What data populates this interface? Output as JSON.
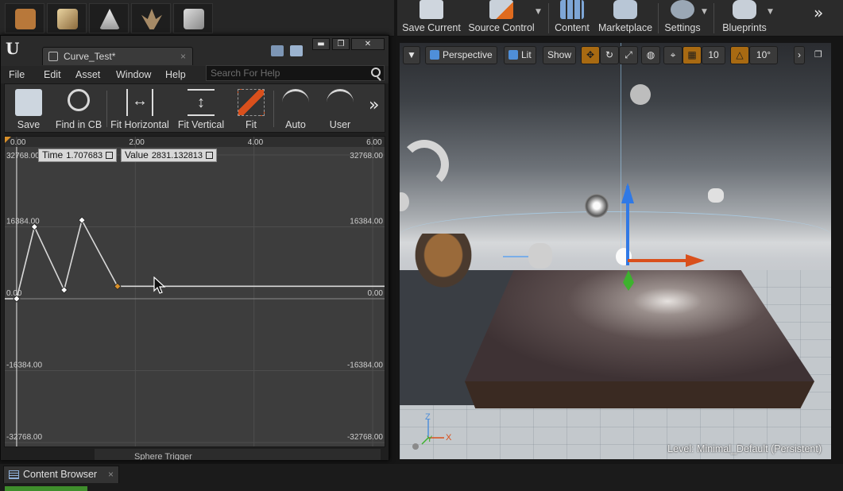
{
  "main_toolbar": {
    "buttons": [
      {
        "label": "Save Current",
        "icon": "save-icon"
      },
      {
        "label": "Source Control",
        "icon": "source-control-icon"
      },
      {
        "label": "Content",
        "icon": "content-icon"
      },
      {
        "label": "Marketplace",
        "icon": "marketplace-icon"
      },
      {
        "label": "Settings",
        "icon": "gear-icon"
      },
      {
        "label": "Blueprints",
        "icon": "blueprints-icon"
      }
    ],
    "more": "»"
  },
  "curve_editor": {
    "tab_title": "Curve_Test*",
    "tab_close": "×",
    "window_buttons": {
      "minimize": "▬",
      "maximize": "❐",
      "close": "✕"
    },
    "menu": [
      "File",
      "Edit",
      "Asset",
      "Window",
      "Help"
    ],
    "search": {
      "placeholder": "Search For Help",
      "value": ""
    },
    "toolbar": [
      {
        "label": "Save",
        "icon": "save-icon"
      },
      {
        "label": "Find in CB",
        "icon": "magnifier-icon"
      },
      {
        "label": "Fit Horizontal",
        "icon": "fit-horizontal-icon"
      },
      {
        "label": "Fit Vertical",
        "icon": "fit-vertical-icon"
      },
      {
        "label": "Fit",
        "icon": "fit-icon"
      },
      {
        "label": "Auto",
        "icon": "auto-tangent-icon"
      },
      {
        "label": "User",
        "icon": "user-tangent-icon"
      }
    ],
    "toolbar_more": "»",
    "time_box": {
      "label": "Time",
      "value": "1.707683"
    },
    "value_box": {
      "label": "Value",
      "value": "2831.132813"
    },
    "bottom_strip_text": "Sphere Trigger"
  },
  "chart_data": {
    "type": "line",
    "x_ticks": [
      "0.00",
      "2.00",
      "4.00",
      "6.00"
    ],
    "y_ticks_left": [
      "32768.00",
      "16384.00",
      "0.00",
      "-16384.00",
      "-32768.00"
    ],
    "y_ticks_right": [
      "32768.00",
      "16384.00",
      "0.00",
      "-16384.00",
      "-32768.00"
    ],
    "xlim": [
      -0.2,
      6.2
    ],
    "ylim": [
      -32768,
      32768
    ],
    "keys": [
      {
        "x": 0.0,
        "y": 0
      },
      {
        "x": 0.3,
        "y": 16384
      },
      {
        "x": 0.8,
        "y": 2000
      },
      {
        "x": 1.1,
        "y": 17900
      },
      {
        "x": 1.7,
        "y": 2831
      }
    ],
    "extend_to": 6.2,
    "grid": true
  },
  "viewport": {
    "perspective_label": "Perspective",
    "lit_label": "Lit",
    "show_label": "Show",
    "grid_snap": "10",
    "rotation_snap": "10°",
    "level_text": "Level:  Minimal_Default (Persistent)",
    "axis_labels": {
      "z": "Z",
      "x": "X",
      "y": "Y"
    }
  },
  "content_browser": {
    "tab_label": "Content Browser",
    "tab_close": "×"
  },
  "colors": {
    "accent_orange": "#a86a12",
    "gizmo_blue": "#2f79e6",
    "gizmo_red": "#d9501c",
    "gizmo_green": "#3db22e"
  }
}
